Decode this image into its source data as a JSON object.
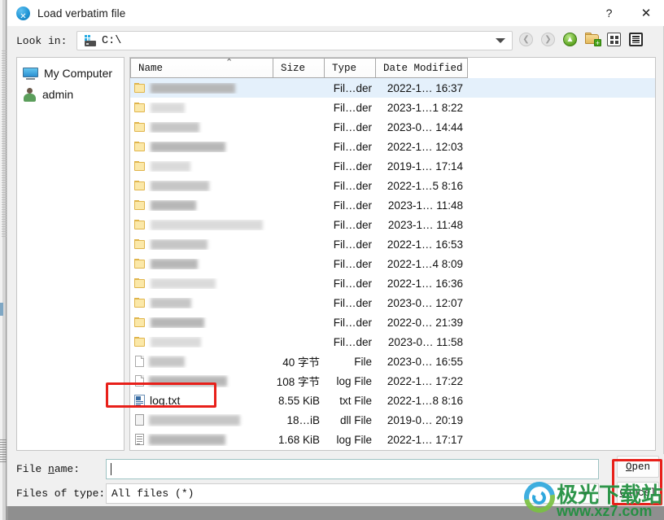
{
  "window": {
    "title": "Load verbatim file",
    "app_icon": "x-app-icon",
    "help_label": "?",
    "close_label": "✕"
  },
  "lookin": {
    "label": "Look in:",
    "path": "C:\\",
    "drive_icon": "drive-icon",
    "dropdown_icon": "chevron-down-icon",
    "tools": [
      {
        "name": "back-icon",
        "glyph": "❮",
        "style": "gray"
      },
      {
        "name": "forward-icon",
        "glyph": "❯",
        "style": "gray"
      },
      {
        "name": "parent-directory-icon",
        "glyph": "▲",
        "style": "green"
      },
      {
        "name": "new-folder-icon",
        "glyph": "+",
        "style": "folder"
      },
      {
        "name": "list-view-icon",
        "glyph": "",
        "style": "grid"
      },
      {
        "name": "detail-view-icon",
        "glyph": "",
        "style": "list"
      }
    ]
  },
  "sidebar": {
    "items": [
      {
        "label": "My Computer",
        "icon": "computer-icon"
      },
      {
        "label": "admin",
        "icon": "user-icon"
      }
    ]
  },
  "filelist": {
    "columns": [
      {
        "key": "name",
        "label": "Name",
        "sorted": true,
        "sort_glyph": "⌃"
      },
      {
        "key": "size",
        "label": "Size"
      },
      {
        "key": "type",
        "label": "Type"
      },
      {
        "key": "date",
        "label": "Date Modified"
      }
    ],
    "rows": [
      {
        "name": "",
        "redacted": true,
        "redact_w": 104,
        "icon": "folder-icon",
        "size": "",
        "type": "Fil…der",
        "date": "2022-1… 16:37",
        "selected": true
      },
      {
        "name": "",
        "redacted": true,
        "redact_w": 42,
        "icon": "folder-icon",
        "size": "",
        "type": "Fil…der",
        "date": "2023-1…1 8:22",
        "selected": false
      },
      {
        "name": "",
        "redacted": true,
        "redact_w": 60,
        "icon": "folder-icon",
        "size": "",
        "type": "Fil…der",
        "date": "2023-0… 14:44",
        "selected": false
      },
      {
        "name": "",
        "redacted": true,
        "redact_w": 92,
        "icon": "folder-icon",
        "size": "",
        "type": "Fil…der",
        "date": "2022-1… 12:03",
        "selected": false
      },
      {
        "name": "",
        "redacted": true,
        "redact_w": 49,
        "icon": "folder-icon",
        "size": "",
        "type": "Fil…der",
        "date": "2019-1… 17:14",
        "selected": false
      },
      {
        "name": "",
        "redacted": true,
        "redact_w": 72,
        "icon": "folder-icon",
        "size": "",
        "type": "Fil…der",
        "date": "2022-1…5 8:16",
        "selected": false
      },
      {
        "name": "",
        "redacted": true,
        "redact_w": 56,
        "icon": "folder-icon",
        "size": "",
        "type": "Fil…der",
        "date": "2023-1… 11:48",
        "selected": false
      },
      {
        "name": "",
        "redacted": true,
        "redact_w": 138,
        "icon": "folder-icon",
        "size": "",
        "type": "Fil…der",
        "date": "2023-1… 11:48",
        "selected": false
      },
      {
        "name": "",
        "redacted": true,
        "redact_w": 70,
        "icon": "folder-icon",
        "size": "",
        "type": "Fil…der",
        "date": "2022-1… 16:53",
        "selected": false
      },
      {
        "name": "",
        "redacted": true,
        "redact_w": 58,
        "icon": "folder-icon",
        "size": "",
        "type": "Fil…der",
        "date": "2022-1…4 8:09",
        "selected": false
      },
      {
        "name": "",
        "redacted": true,
        "redact_w": 80,
        "icon": "folder-icon",
        "size": "",
        "type": "Fil…der",
        "date": "2022-1… 16:36",
        "selected": false
      },
      {
        "name": "",
        "redacted": true,
        "redact_w": 50,
        "icon": "folder-icon",
        "size": "",
        "type": "Fil…der",
        "date": "2023-0… 12:07",
        "selected": false
      },
      {
        "name": "",
        "redacted": true,
        "redact_w": 66,
        "icon": "folder-icon",
        "size": "",
        "type": "Fil…der",
        "date": "2022-0… 21:39",
        "selected": false
      },
      {
        "name": "",
        "redacted": true,
        "redact_w": 62,
        "icon": "folder-icon",
        "size": "",
        "type": "Fil…der",
        "date": "2023-0… 11:58",
        "selected": false
      },
      {
        "name": "",
        "redacted": true,
        "redact_w": 44,
        "icon": "file-icon",
        "size": "40 字节",
        "type": "File",
        "date": "2023-0… 16:55",
        "selected": false
      },
      {
        "name": "",
        "redacted": true,
        "redact_w": 96,
        "icon": "file-icon",
        "size": "108 字节",
        "type": "log File",
        "date": "2022-1… 17:22",
        "selected": false
      },
      {
        "name": "log.txt",
        "redacted": false,
        "redact_w": 0,
        "icon": "text-file-icon",
        "size": "8.55 KiB",
        "type": "txt File",
        "date": "2022-1…8 8:16",
        "selected": false
      },
      {
        "name": "",
        "redacted": true,
        "redact_w": 112,
        "icon": "dll-file-icon",
        "size": "18…iB",
        "type": "dll File",
        "date": "2019-0… 20:19",
        "selected": false
      },
      {
        "name": "",
        "redacted": true,
        "redact_w": 94,
        "icon": "log-file-icon",
        "size": "1.68 KiB",
        "type": "log File",
        "date": "2022-1… 17:17",
        "selected": false
      }
    ]
  },
  "footer": {
    "filename_label_pre": "File ",
    "filename_label_key": "n",
    "filename_label_post": "ame:",
    "filename_label": "File name:",
    "filename_value": "",
    "filetype_label": "Files of type:",
    "filetype_value": "All files (*)",
    "open_label_key": "O",
    "open_label_rest": "pen",
    "open_label": "Open",
    "cancel_label_key": "C",
    "cancel_label_rest": "ancel",
    "cancel_label": "Cancel"
  },
  "annotations": {
    "highlight_logtxt": "red-box-around-log-txt",
    "highlight_buttons": "red-box-around-open-cancel"
  },
  "watermark": {
    "chinese": "极光下载站",
    "url": "www.xz7.com"
  },
  "colors": {
    "selection": "#e4f0fb",
    "annotation_red": "#e8201a",
    "watermark_green": "#1f8f3e",
    "accent_blue": "#2196d6"
  }
}
